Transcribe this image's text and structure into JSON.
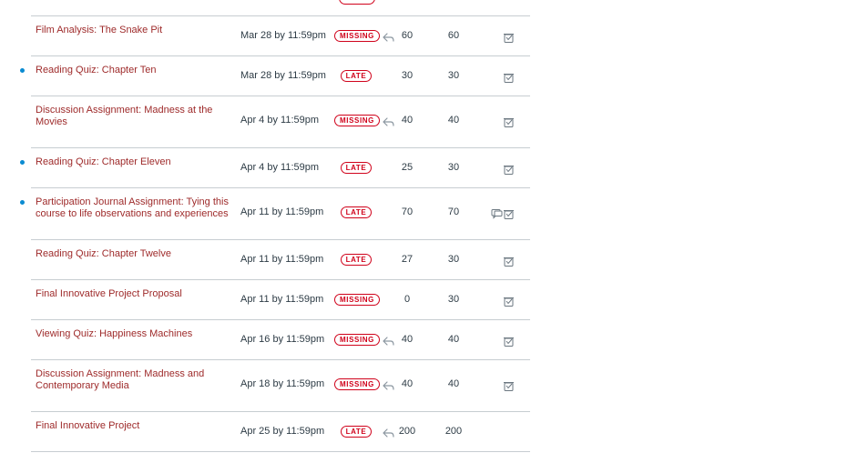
{
  "assignments": [
    {
      "title": "Film Analysis: The Snake Pit",
      "due": "Mar 28 by 11:59pm",
      "status": "MISSING",
      "score": "60",
      "out_of": "60",
      "unread": false,
      "reply_icon": true,
      "comment_icon": false,
      "rubric_icon": true
    },
    {
      "title": "Reading Quiz: Chapter Ten",
      "due": "Mar 28 by 11:59pm",
      "status": "LATE",
      "score": "30",
      "out_of": "30",
      "unread": true,
      "reply_icon": false,
      "comment_icon": false,
      "rubric_icon": true
    },
    {
      "title": "Discussion Assignment: Madness at the Movies",
      "due": "Apr 4 by 11:59pm",
      "status": "MISSING",
      "score": "40",
      "out_of": "40",
      "unread": false,
      "reply_icon": true,
      "comment_icon": false,
      "rubric_icon": true
    },
    {
      "title": "Reading Quiz: Chapter Eleven",
      "due": "Apr 4 by 11:59pm",
      "status": "LATE",
      "score": "25",
      "out_of": "30",
      "unread": true,
      "reply_icon": false,
      "comment_icon": false,
      "rubric_icon": true
    },
    {
      "title": "Participation Journal Assignment: Tying this course to life observations and experiences",
      "due": "Apr 11 by 11:59pm",
      "status": "LATE",
      "score": "70",
      "out_of": "70",
      "unread": true,
      "reply_icon": false,
      "comment_icon": true,
      "rubric_icon": true
    },
    {
      "title": "Reading Quiz: Chapter Twelve",
      "due": "Apr 11 by 11:59pm",
      "status": "LATE",
      "score": "27",
      "out_of": "30",
      "unread": false,
      "reply_icon": false,
      "comment_icon": false,
      "rubric_icon": true
    },
    {
      "title": "Final Innovative Project Proposal",
      "due": "Apr 11 by 11:59pm",
      "status": "MISSING",
      "score": "0",
      "out_of": "30",
      "unread": false,
      "reply_icon": false,
      "comment_icon": false,
      "rubric_icon": true
    },
    {
      "title": "Viewing Quiz: Happiness Machines",
      "due": "Apr 16 by 11:59pm",
      "status": "MISSING",
      "score": "40",
      "out_of": "40",
      "unread": false,
      "reply_icon": true,
      "comment_icon": false,
      "rubric_icon": true
    },
    {
      "title": "Discussion Assignment: Madness and Contemporary Media",
      "due": "Apr 18 by 11:59pm",
      "status": "MISSING",
      "score": "40",
      "out_of": "40",
      "unread": false,
      "reply_icon": true,
      "comment_icon": false,
      "rubric_icon": true
    },
    {
      "title": "Final Innovative Project",
      "due": "Apr 25 by 11:59pm",
      "status": "LATE",
      "score": "200",
      "out_of": "200",
      "unread": false,
      "reply_icon": true,
      "comment_icon": false,
      "rubric_icon": false
    }
  ],
  "colors": {
    "link": "#9e2a2a",
    "status": "#d0021b",
    "unread_dot": "#0a8bd1",
    "divider": "#c7cdd1"
  }
}
